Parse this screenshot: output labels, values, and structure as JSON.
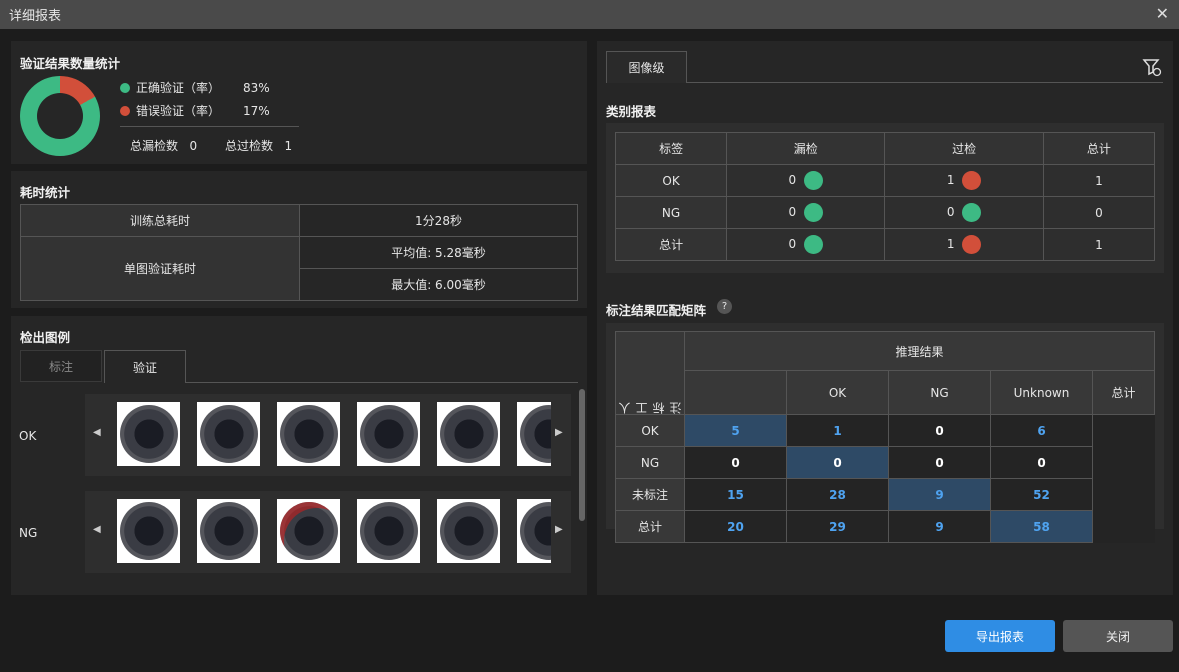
{
  "window": {
    "title": "详细报表"
  },
  "summary": {
    "title": "验证结果数量统计",
    "correct_label": "正确验证（率）",
    "correct_value": "83%",
    "error_label": "错误验证（率）",
    "error_value": "17%",
    "correct_fraction": 0.83,
    "missed_label": "总漏检数",
    "missed_value": "0",
    "over_label": "总过检数",
    "over_value": "1",
    "colors": {
      "correct": "#3dba84",
      "error": "#d24f3a"
    }
  },
  "timing": {
    "title": "耗时统计",
    "train_label": "训练总耗时",
    "train_value": "1分28秒",
    "single_label": "单图验证耗时",
    "avg": "平均值: 5.28毫秒",
    "max": "最大值: 6.00毫秒"
  },
  "examples": {
    "title": "检出图例",
    "tabs": [
      "标注",
      "验证"
    ],
    "rows": [
      {
        "label": "OK"
      },
      {
        "label": "NG"
      }
    ]
  },
  "right": {
    "tab": "图像级",
    "category_title": "类别报表",
    "category_headers": [
      "标签",
      "漏检",
      "过检",
      "总计"
    ],
    "category_rows": [
      {
        "label": "OK",
        "missed": "0",
        "missed_color": "green",
        "over": "1",
        "over_color": "red",
        "total": "1"
      },
      {
        "label": "NG",
        "missed": "0",
        "missed_color": "green",
        "over": "0",
        "over_color": "green",
        "total": "0"
      },
      {
        "label": "总计",
        "missed": "0",
        "missed_color": "green",
        "over": "1",
        "over_color": "red",
        "total": "1"
      }
    ],
    "matrix_title": "标注结果匹配矩阵",
    "help": "?",
    "matrix": {
      "col_group": "推理结果",
      "row_group": "人工标注",
      "cols": [
        "OK",
        "NG",
        "Unknown",
        "总计"
      ],
      "rows": [
        {
          "label": "OK",
          "values": [
            "5",
            "1",
            "0",
            "6"
          ]
        },
        {
          "label": "NG",
          "values": [
            "0",
            "0",
            "0",
            "0"
          ]
        },
        {
          "label": "未标注",
          "values": [
            "15",
            "28",
            "9",
            "52"
          ]
        },
        {
          "label": "总计",
          "values": [
            "20",
            "29",
            "9",
            "58"
          ]
        }
      ]
    }
  },
  "buttons": {
    "export": "导出报表",
    "close": "关闭"
  }
}
